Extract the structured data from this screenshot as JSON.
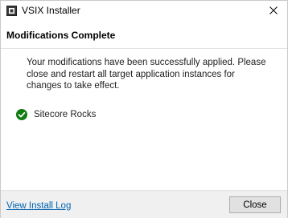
{
  "window": {
    "title": "VSIX Installer",
    "icon": "vsix-installer-icon",
    "close_icon": "close-icon"
  },
  "header": {
    "title": "Modifications Complete"
  },
  "content": {
    "message": "Your modifications have been successfully applied. Please close and restart all target application instances for changes to take effect.",
    "extensions": [
      {
        "name": "Sitecore Rocks",
        "status_icon": "success-check-icon",
        "status_color": "#107c10"
      }
    ]
  },
  "footer": {
    "log_link": "View Install Log",
    "close_button": "Close"
  },
  "colors": {
    "link": "#0063b1",
    "success": "#107c10",
    "footer_bg": "#f0f0f0",
    "button_bg": "#e1e1e1"
  }
}
